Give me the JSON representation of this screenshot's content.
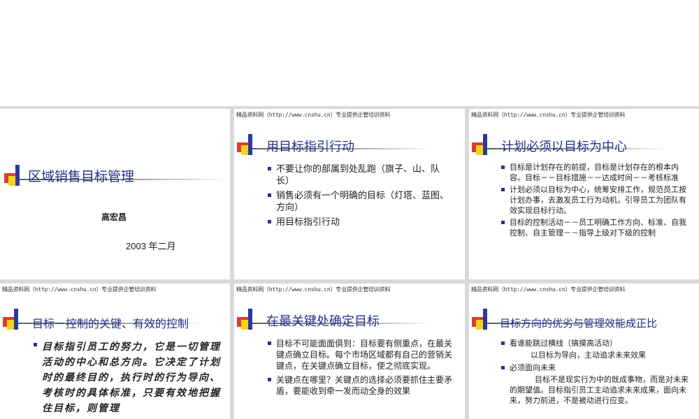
{
  "header": "精品资料网（http://www.cnshu.cn）专业提供企管培训资料",
  "slides": [
    {
      "title": "区域销售目标管理",
      "author": "高宏昌",
      "date": "2003 年二月"
    },
    {
      "title": "用目标指引行动",
      "bullets": [
        "不要让你的部属到处乱跑（旗子、山、队长）",
        "销售必须有一个明确的目标（灯塔、蓝图、方向）",
        "用目标指引行动"
      ]
    },
    {
      "title": "计划必须以目标为中心",
      "bullets": [
        "目标是计划存在的前提，目标是计划存在的根本内容。目标－－目标措施－－达成时间－－考核标准",
        "计划必须以目标为中心，统筹安排工作，规范员工按计划办事，去激发员工行为动机，引导员工为团队有效实现目标行动。",
        "目标的控制活动－－员工明确工作方向、标准、自我控制、自主管理－－指导上级对下级的控制"
      ]
    },
    {
      "title": "目标－控制的关键、有效的控制",
      "bullets": [
        "目标指引员工的努力，它是一切管理活动的中心和总方向。它决定了计划时的最终目的，执行时的行为导向、考核时的具体标准，只要有效地把握住目标，则管理"
      ]
    },
    {
      "title": "在最关键处确定目标",
      "bullets": [
        "目标不可能面面俱到：目标要有侧重点，在最关键点确立目标。每个市场区域都有自己的营销关键点，在关键点确立目标，使之彻底实现。",
        "关键点在哪里？关键点的选择必须要抓住主要矛盾，要能收到牵一发而动全身的效果"
      ]
    },
    {
      "title": "目标方向的优劣与管理效能成正比",
      "bullets": [
        "看谁能跳过横线（搞摸高活动）",
        "必须面向未来"
      ],
      "sub1": "以目标为导向，主动追求未来效果",
      "sub2": "目标不是现实行为中的既成事物，而是对未来的期望值。目标指引员工主动追求未来成果，面向未来，努力前进，不是被动进行应变。"
    }
  ]
}
